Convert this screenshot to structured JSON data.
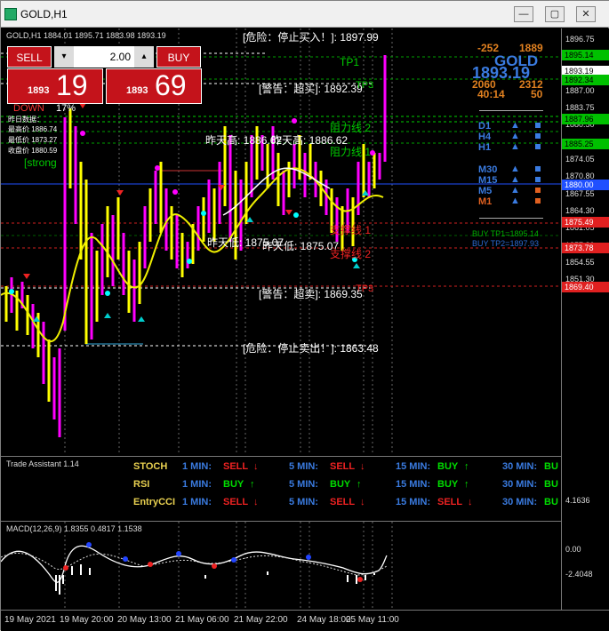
{
  "window": {
    "title": "GOLD,H1",
    "min": "—",
    "max": "▢",
    "close": "✕"
  },
  "chart": {
    "header": "GOLD,H1  1884.01 1895.71 1883.98 1893.19",
    "sell_label": "SELL",
    "buy_label": "BUY",
    "lot": "2.00",
    "sell_small": "1893",
    "sell_big": "19",
    "buy_small": "1893",
    "buy_big": "69",
    "down_label": "DOWN",
    "down_pct": "17%",
    "info_title": "昨日数据：",
    "info_high": "最高价 1886.74",
    "info_low": "最低价 1873.27",
    "info_close": "收盘价 1880.59",
    "strong": "[strong",
    "danger_buy": "[危险：停止买入！]: 1897.99",
    "warn_overbuy": "[警告：超买]: 1892.39",
    "tp1": "TP1",
    "tp3": "TP3",
    "r2": "阻力线 2",
    "r1": "阻力线 1",
    "yest_high": "昨天高: 1886.62",
    "yest_high2": "昨天高: 1886.62",
    "yest_low": "昨天低: 1875.07",
    "yest_low2": "昨天低: 1875.07",
    "s1": "支撑线 1",
    "s2": "支撑线 2",
    "s3": "TP3",
    "warn_oversell": "[警告：超卖]: 1869.35",
    "danger_sell": "[危险：停止卖出！]: 1863.48"
  },
  "right_panel": {
    "v1": "-252",
    "v2": "1889",
    "symbol": "GOLD",
    "price": "1893.19",
    "v3": "2060",
    "v4": "2312",
    "time": "40:14",
    "v5": "50",
    "timeframes": [
      "D1",
      "H4",
      "H1",
      "M30",
      "M15",
      "M5",
      "M1"
    ],
    "buy_tp1": "BUY TP1=1895.14",
    "buy_tp2": "BUY TP2=1897.93"
  },
  "price_axis": {
    "ticks": [
      "1896.75",
      "1893.50",
      "1890.25",
      "1887.00",
      "1883.75",
      "1880.50",
      "1877.30",
      "1874.05",
      "1870.80",
      "1867.55",
      "1864.30",
      "1861.05",
      "1857.80",
      "1854.55",
      "1851.30"
    ],
    "labels": [
      {
        "text": "1895.14",
        "color": "#00c000"
      },
      {
        "text": "1893.19",
        "color": "#ffffff"
      },
      {
        "text": "1892.34",
        "color": "#00c000"
      },
      {
        "text": "1887.96",
        "color": "#00c000"
      },
      {
        "text": "1885.25",
        "color": "#00c000"
      },
      {
        "text": "1880.00",
        "color": "#2050ff"
      },
      {
        "text": "1875.49",
        "color": "#e02020"
      },
      {
        "text": "1873.78",
        "color": "#e02020"
      },
      {
        "text": "1869.40",
        "color": "#e02020"
      }
    ]
  },
  "assistant": {
    "title": "Trade Assistant 1.14",
    "rows": [
      {
        "name": "STOCH",
        "s1": "SELL",
        "s5": "SELL",
        "s15": "BUY",
        "s30": "BU"
      },
      {
        "name": "RSI",
        "s1": "BUY",
        "s5": "BUY",
        "s15": "BUY",
        "s30": "BU"
      },
      {
        "name": "EntryCCI",
        "s1": "SELL",
        "s5": "SELL",
        "s15": "SELL",
        "s30": "BU"
      }
    ],
    "min1": "1 MIN:",
    "min5": "5 MIN:",
    "min15": "15 MIN:",
    "min30": "30 MIN:"
  },
  "macd": {
    "title": "MACD(12,26,9) 1.8355 0.4817 1.1538",
    "top": "4.1636",
    "zero": "0.00",
    "bottom": "-2.4048"
  },
  "time_axis": {
    "ticks": [
      "19 May 2021",
      "19 May 20:00",
      "20 May 13:00",
      "21 May 06:00",
      "21 May 22:00",
      "24 May 18:00",
      "25 May 11:00"
    ]
  }
}
